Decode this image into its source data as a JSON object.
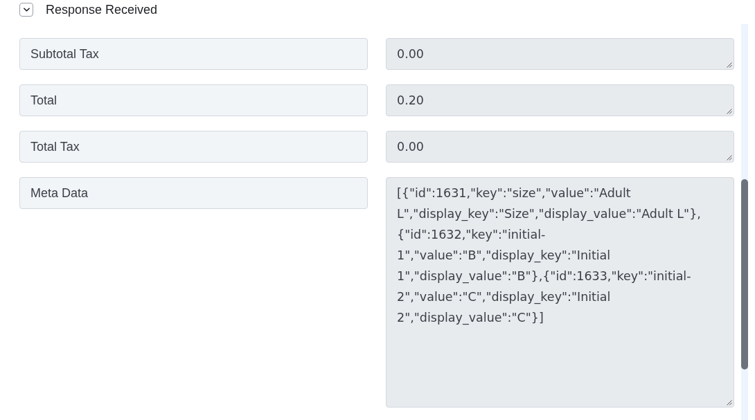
{
  "section": {
    "title": "Response Received",
    "expanded": true
  },
  "fields": [
    {
      "key": "Subtotal Tax",
      "value": "0.00",
      "kind": "single"
    },
    {
      "key": "Total",
      "value": "0.20",
      "kind": "single"
    },
    {
      "key": "Total Tax",
      "value": "0.00",
      "kind": "single"
    },
    {
      "key": "Meta Data",
      "value": "[{\"id\":1631,\"key\":\"size\",\"value\":\"Adult L\",\"display_key\":\"Size\",\"display_value\":\"Adult L\"},{\"id\":1632,\"key\":\"initial-1\",\"value\":\"B\",\"display_key\":\"Initial 1\",\"display_value\":\"B\"},{\"id\":1633,\"key\":\"initial-2\",\"value\":\"C\",\"display_key\":\"Initial 2\",\"display_value\":\"C\"}]",
      "kind": "multi"
    }
  ]
}
